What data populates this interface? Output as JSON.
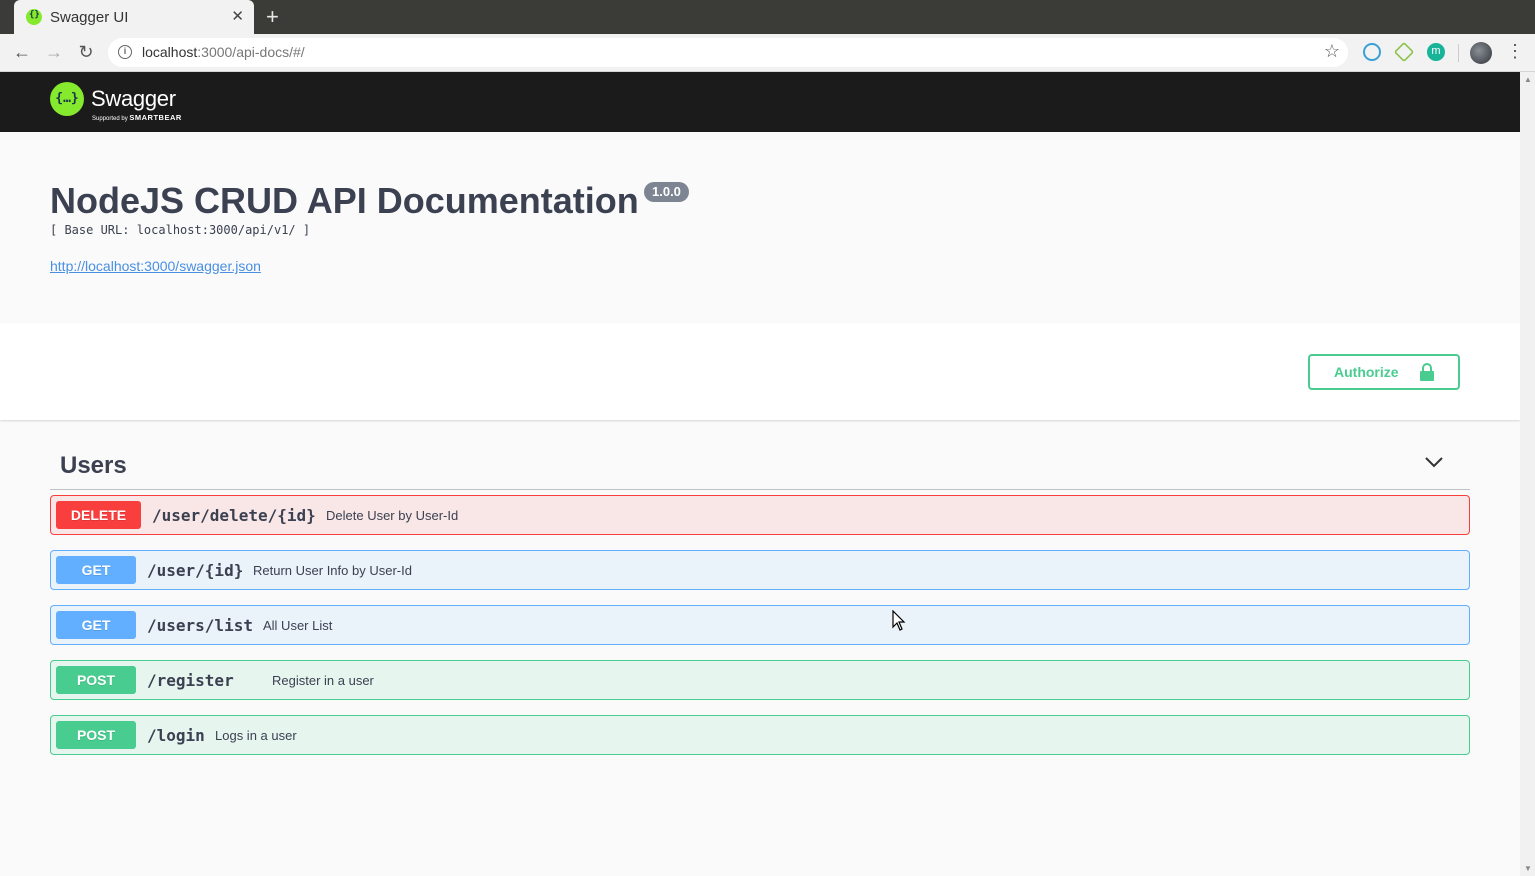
{
  "browser": {
    "tab_title": "Swagger UI",
    "tab_close": "✕",
    "new_tab": "+",
    "url_host": "localhost",
    "url_rest": ":3000/api-docs/#/",
    "ext3_letter": "m"
  },
  "swagger": {
    "logo_glyph": "{…}",
    "brand": "Swagger",
    "supported_by": "Supported by",
    "smartbear": "SMARTBEAR"
  },
  "info": {
    "title": "NodeJS CRUD API Documentation",
    "version": "1.0.0",
    "base_url": "[ Base URL: localhost:3000/api/v1/ ]",
    "spec_link": "http://localhost:3000/swagger.json"
  },
  "authorize": {
    "label": "Authorize"
  },
  "tag": {
    "name": "Users"
  },
  "operations": [
    {
      "method": "DELETE",
      "path": "/user/delete/{id}",
      "summary": "Delete User by User-Id"
    },
    {
      "method": "GET",
      "path": "/user/{id}",
      "summary": "Return User Info by User-Id"
    },
    {
      "method": "GET",
      "path": "/users/list",
      "summary": "All User List"
    },
    {
      "method": "POST",
      "path": "/register",
      "summary": "Register in a user"
    },
    {
      "method": "POST",
      "path": "/login",
      "summary": "Logs in a user"
    }
  ],
  "colors": {
    "delete": "#f93e3e",
    "get": "#61affe",
    "post": "#49cc90",
    "swagger_green": "#85ea2d",
    "topbar": "#1b1b1b"
  }
}
